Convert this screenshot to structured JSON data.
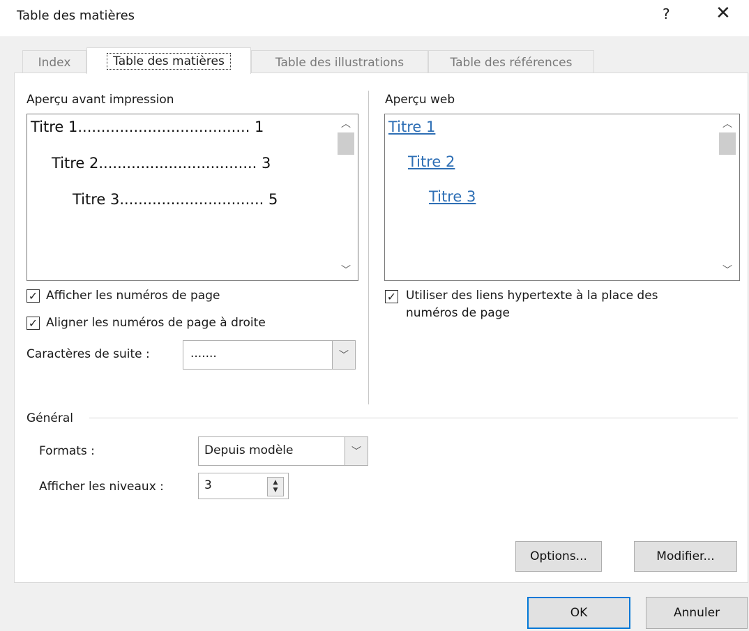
{
  "window": {
    "title": "Table des matières",
    "help_label": "?",
    "close_label": "✕"
  },
  "tabs": [
    {
      "label": "Index",
      "active": false
    },
    {
      "label": "Table des matières",
      "active": true
    },
    {
      "label": "Table des illustrations",
      "active": false
    },
    {
      "label": "Table des références",
      "active": false
    }
  ],
  "print_preview": {
    "label": "Aperçu avant impression",
    "entries": [
      {
        "text": "Titre 1..................................... 1"
      },
      {
        "text": "Titre 2.................................. 3"
      },
      {
        "text": "Titre 3............................... 5"
      }
    ],
    "show_page_numbers": {
      "label": "Afficher les numéros de page",
      "checked": true
    },
    "align_right": {
      "label": "Aligner les numéros de page à droite",
      "checked": true
    },
    "tab_leader": {
      "label": "Caractères de suite :",
      "value": "......."
    }
  },
  "web_preview": {
    "label": "Aperçu web",
    "links": [
      "Titre 1",
      "Titre 2",
      "Titre 3"
    ],
    "use_hyperlinks": {
      "label_line1": "Utiliser des liens hypertexte à la place des",
      "label_line2": "numéros de page",
      "checked": true
    }
  },
  "general": {
    "label": "Général",
    "formats": {
      "label": "Formats :",
      "value": "Depuis modèle"
    },
    "levels": {
      "label": "Afficher les niveaux :",
      "value": "3"
    }
  },
  "buttons": {
    "options": "Options...",
    "modify": "Modifier...",
    "ok": "OK",
    "cancel": "Annuler"
  }
}
